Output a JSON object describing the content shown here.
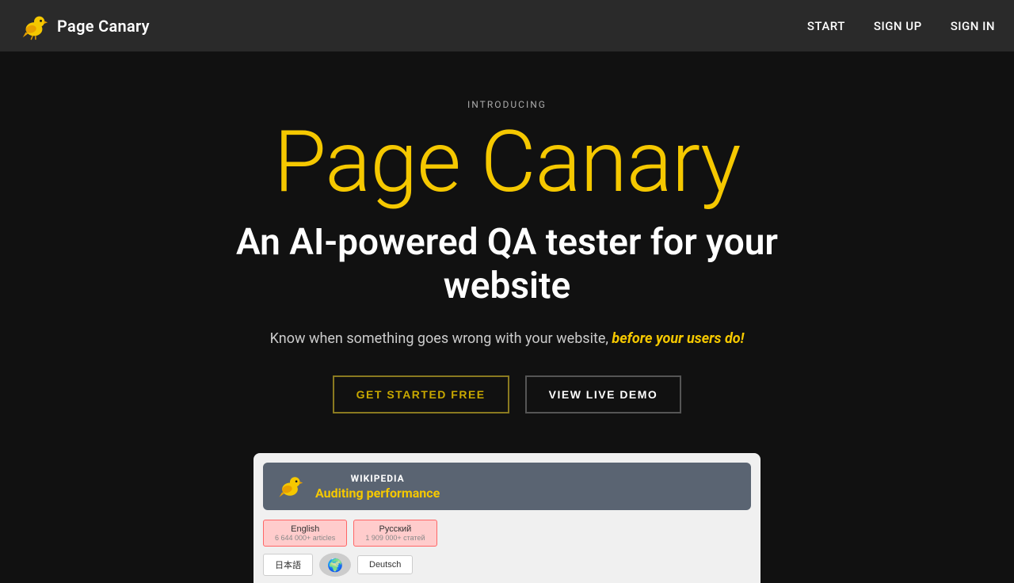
{
  "nav": {
    "brand": "Page Canary",
    "links": [
      "START",
      "SIGN UP",
      "SIGN IN"
    ]
  },
  "hero": {
    "introducing": "INTRODUCING",
    "title": "Page Canary",
    "subtitle": "An AI-powered QA tester for your website",
    "desc_normal": "Know when something goes wrong with your website, ",
    "desc_highlight": "before your users do!",
    "btn_primary": "GET STARTED FREE",
    "btn_secondary": "VIEW LIVE DEMO"
  },
  "demo": {
    "site_name": "WIKIPEDIA",
    "auditing_label": "Auditing performance",
    "lang_en": "English",
    "lang_en_count": "6 644 000+ articles",
    "lang_ru": "Русский",
    "lang_ru_count": "1 909 000+ статей",
    "lang_ja": "日本語",
    "lang_de": "Deutsch"
  },
  "colors": {
    "accent": "#f5c800",
    "bg_dark": "#111111",
    "nav_bg": "#2a2a2a"
  }
}
